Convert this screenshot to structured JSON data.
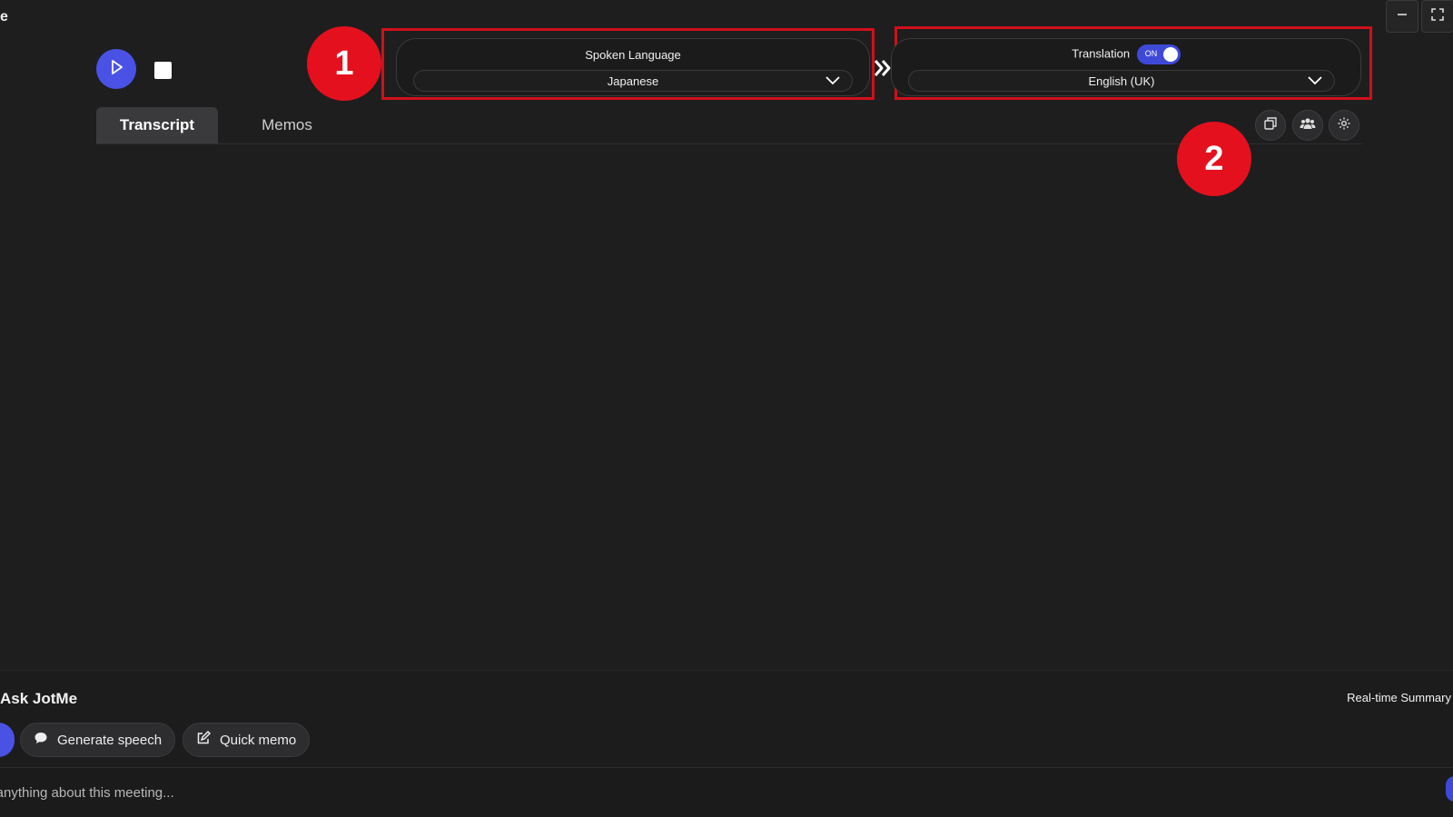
{
  "app": {
    "title_fragment": "e"
  },
  "window_controls": {
    "minimize_icon": "minimize-icon",
    "fullscreen_icon": "fullscreen-icon"
  },
  "recorder": {
    "play_icon": "play-icon",
    "stop_icon": "stop-icon",
    "accent": "#4a52e6"
  },
  "spoken_language": {
    "label": "Spoken Language",
    "value": "Japanese"
  },
  "translation": {
    "label": "Translation",
    "toggle_text": "ON",
    "enabled": true,
    "value": "English (UK)"
  },
  "annotations": {
    "badge_1": "1",
    "badge_2": "2",
    "highlight_color": "#d0101a"
  },
  "tabs": [
    {
      "label": "Transcript",
      "active": true
    },
    {
      "label": "Memos",
      "active": false
    }
  ],
  "toolbar": {
    "icons": [
      "copy-icon",
      "speakers-icon",
      "settings-icon"
    ]
  },
  "ask": {
    "title": "Ask JotMe",
    "summary_link": "Real-time Summary",
    "chips": [
      {
        "label": "Generate speech",
        "icon": "chat-bubble-icon"
      },
      {
        "label": "Quick memo",
        "icon": "edit-icon"
      }
    ],
    "input_placeholder": "k anything about this meeting..."
  }
}
